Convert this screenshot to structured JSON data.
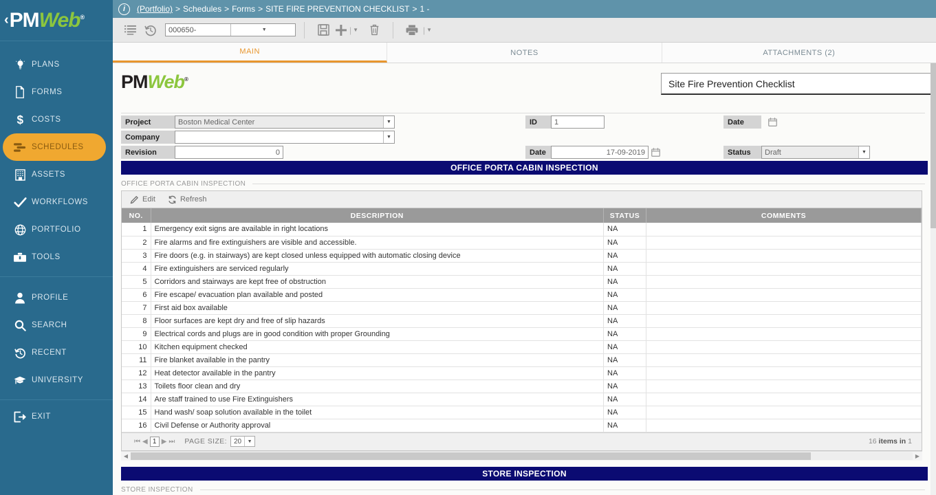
{
  "brand": {
    "name_part1": "PM",
    "name_part2": "Web",
    "registered": "®",
    "chevron": "‹"
  },
  "sidebar": {
    "items": [
      {
        "label": "PLANS",
        "icon": "lightbulb-icon",
        "active": false
      },
      {
        "label": "FORMS",
        "icon": "document-icon",
        "active": false
      },
      {
        "label": "COSTS",
        "icon": "dollar-icon",
        "active": false
      },
      {
        "label": "SCHEDULES",
        "icon": "schedule-bars-icon",
        "active": true
      },
      {
        "label": "ASSETS",
        "icon": "building-icon",
        "active": false
      },
      {
        "label": "WORKFLOWS",
        "icon": "check-icon",
        "active": false
      },
      {
        "label": "PORTFOLIO",
        "icon": "globe-icon",
        "active": false
      },
      {
        "label": "TOOLS",
        "icon": "toolbox-icon",
        "active": false
      }
    ],
    "lower_items": [
      {
        "label": "PROFILE",
        "icon": "person-icon"
      },
      {
        "label": "SEARCH",
        "icon": "search-icon"
      },
      {
        "label": "RECENT",
        "icon": "history-icon"
      },
      {
        "label": "UNIVERSITY",
        "icon": "graduation-cap-icon"
      }
    ],
    "exit": {
      "label": "EXIT",
      "icon": "exit-icon"
    },
    "active_color": "#f0a830",
    "background_color": "#296a8d"
  },
  "breadcrumb": {
    "info_glyph": "i",
    "root": "(Portfolio)",
    "separator": ">",
    "parts": [
      "Schedules",
      "Forms",
      "SITE FIRE PREVENTION CHECKLIST",
      "1 -"
    ]
  },
  "toolbar": {
    "list_icon": "list-icon",
    "history_icon": "history-icon",
    "record_value": "000650-",
    "save_icon": "save-icon",
    "add_icon": "add-icon",
    "delete_icon": "trash-icon",
    "print_icon": "print-icon"
  },
  "tabs": [
    {
      "label": "MAIN",
      "active": true
    },
    {
      "label": "NOTES",
      "active": false
    },
    {
      "label": "ATTACHMENTS (2)",
      "active": false
    }
  ],
  "form": {
    "title_value": "Site Fire Prevention Checklist",
    "fields": {
      "project": {
        "label": "Project",
        "value": "Boston Medical Center"
      },
      "company": {
        "label": "Company",
        "value": ""
      },
      "revision": {
        "label": "Revision",
        "value": "0"
      },
      "id": {
        "label": "ID",
        "value": "1"
      },
      "date_left": {
        "label": "Date",
        "value": "17-09-2019"
      },
      "date_right": {
        "label": "Date",
        "value": ""
      },
      "status": {
        "label": "Status",
        "value": "Draft"
      }
    }
  },
  "sections": [
    {
      "banner": "OFFICE PORTA CABIN INSPECTION",
      "caption": "OFFICE PORTA CABIN INSPECTION",
      "grid_toolbar": {
        "edit_label": "Edit",
        "edit_icon": "pencil-icon",
        "refresh_label": "Refresh",
        "refresh_icon": "refresh-icon"
      },
      "columns": [
        "NO.",
        "DESCRIPTION",
        "STATUS",
        "COMMENTS"
      ],
      "rows": [
        {
          "no": "1",
          "description": "Emergency exit signs are available in right locations",
          "status": "NA",
          "comments": ""
        },
        {
          "no": "2",
          "description": "Fire alarms and fire extinguishers are visible and accessible.",
          "status": "NA",
          "comments": ""
        },
        {
          "no": "3",
          "description": "Fire doors (e.g. in stairways) are kept closed unless equipped with automatic closing device",
          "status": "NA",
          "comments": ""
        },
        {
          "no": "4",
          "description": "Fire extinguishers are serviced regularly",
          "status": "NA",
          "comments": ""
        },
        {
          "no": "5",
          "description": "Corridors and stairways are kept free of obstruction",
          "status": "NA",
          "comments": ""
        },
        {
          "no": "6",
          "description": "Fire escape/ evacuation plan available and posted",
          "status": "NA",
          "comments": ""
        },
        {
          "no": "7",
          "description": "First aid box available",
          "status": "NA",
          "comments": ""
        },
        {
          "no": "8",
          "description": "Floor surfaces are kept dry and free of slip hazards",
          "status": "NA",
          "comments": ""
        },
        {
          "no": "9",
          "description": "Electrical cords and plugs are in good condition with proper Grounding",
          "status": "NA",
          "comments": ""
        },
        {
          "no": "10",
          "description": "Kitchen equipment checked",
          "status": "NA",
          "comments": ""
        },
        {
          "no": "11",
          "description": "Fire blanket available in the pantry",
          "status": "NA",
          "comments": ""
        },
        {
          "no": "12",
          "description": "Heat detector available in the pantry",
          "status": "NA",
          "comments": ""
        },
        {
          "no": "13",
          "description": "Toilets floor clean and dry",
          "status": "NA",
          "comments": ""
        },
        {
          "no": "14",
          "description": "Are staff trained to use Fire Extinguishers",
          "status": "NA",
          "comments": ""
        },
        {
          "no": "15",
          "description": "Hand wash/ soap solution available in the toilet",
          "status": "NA",
          "comments": ""
        },
        {
          "no": "16",
          "description": "Civil Defense or Authority approval",
          "status": "NA",
          "comments": ""
        }
      ],
      "footer": {
        "page_current": "1",
        "page_size_label": "PAGE SIZE:",
        "page_size_value": "20",
        "items_prefix": "16",
        "items_label": "items in",
        "items_suffix": "1"
      }
    },
    {
      "banner": "STORE INSPECTION",
      "caption": "STORE INSPECTION"
    }
  ],
  "colors": {
    "banner_blue": "#0b0b72",
    "sidebar_blue": "#296a8d",
    "accent_orange": "#e8962e",
    "breadcrumb_blue": "#5f93aa",
    "header_gray": "#9a9a9a"
  }
}
